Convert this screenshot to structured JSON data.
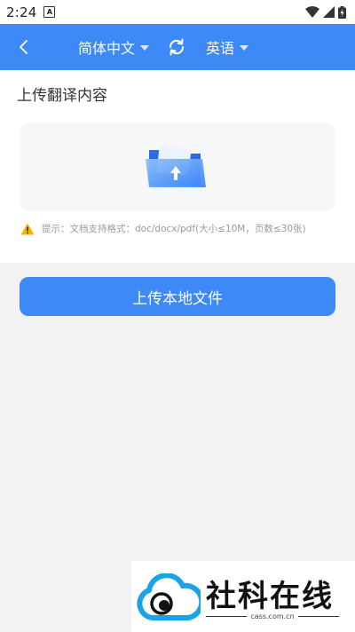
{
  "status_bar": {
    "time": "2:24",
    "notification_letter": "A"
  },
  "header": {
    "source_language": "简体中文",
    "target_language": "英语"
  },
  "upload": {
    "title": "上传翻译内容",
    "tip": "提示：文档支持格式：doc/docx/pdf(大小≤10M，页数≤30张)"
  },
  "primary_button": {
    "label": "上传本地文件"
  },
  "colors": {
    "accent": "#3d8af7",
    "background": "#f2f2f2",
    "warning": "#f5b400"
  },
  "watermark": {
    "brand": "社科在线",
    "url": "cass.com.cn"
  }
}
